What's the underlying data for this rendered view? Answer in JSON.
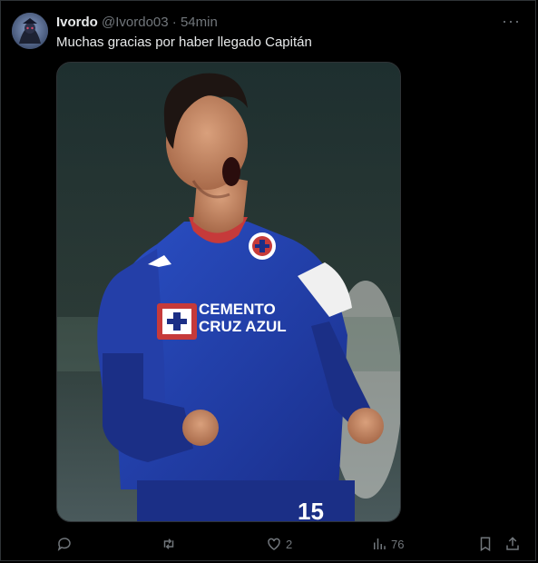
{
  "tweet": {
    "author_name": "Ivordo",
    "handle": "@Ivordo03",
    "separator": "·",
    "time": "54min",
    "more_label": "···",
    "text": "Muchas gracias por haber llegado Capitán"
  },
  "image": {
    "jersey_sponsor_line1": "CEMENTO",
    "jersey_sponsor_line2": "CRUZ AZUL",
    "jersey_number": "15"
  },
  "actions": {
    "reply_count": "",
    "retweet_count": "",
    "like_count": "2",
    "views_count": "76"
  },
  "colors": {
    "background": "#000000",
    "text_primary": "#e7e9ea",
    "text_secondary": "#71767b",
    "border": "#2f3336",
    "jersey_blue": "#1f3fae"
  },
  "icons": [
    "reply-icon",
    "retweet-icon",
    "like-icon",
    "views-icon",
    "bookmark-icon",
    "share-icon",
    "more-icon"
  ]
}
